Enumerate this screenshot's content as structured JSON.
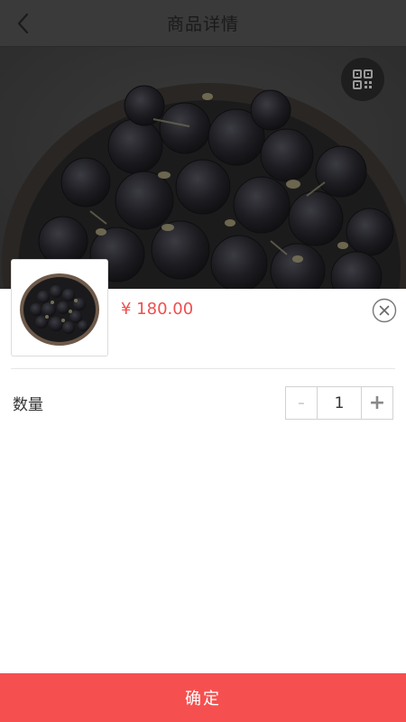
{
  "header": {
    "title": "商品详情",
    "back_icon": "chevron-left-icon"
  },
  "hero": {
    "qr_icon": "qr-code-icon"
  },
  "sheet": {
    "price": "¥ 180.00",
    "close_icon": "close-circle-icon",
    "quantity_label": "数量",
    "quantity_value": "1",
    "minus_label": "-",
    "plus_label": "+",
    "confirm_label": "确定"
  },
  "colors": {
    "accent": "#f5504f",
    "price": "#f04f4f"
  }
}
